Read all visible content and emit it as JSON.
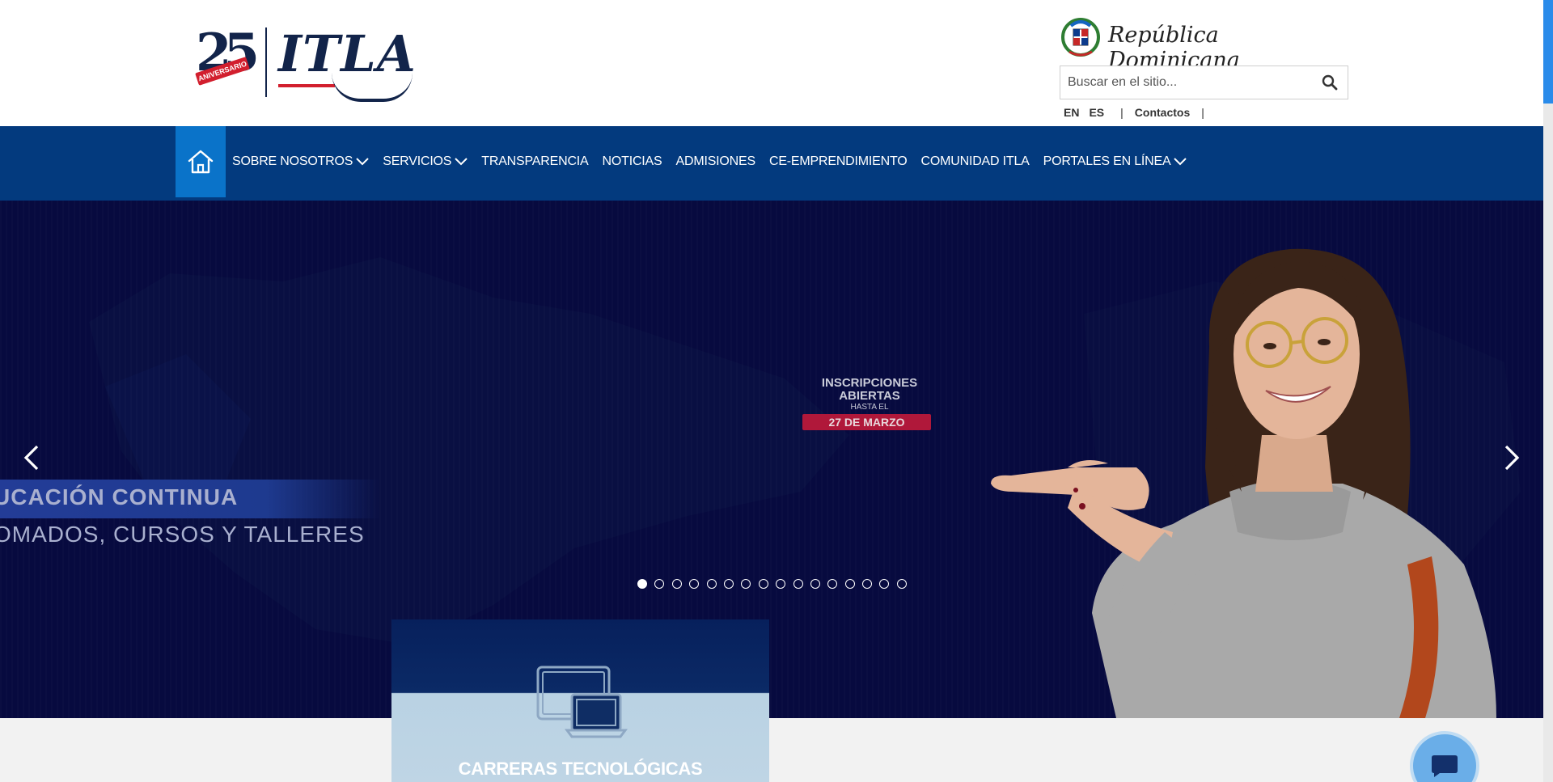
{
  "header": {
    "logo_text": "ITLA",
    "logo_anniversary_number": "25",
    "logo_anniversary_label": "ANIVERSARIO",
    "gov_text": "República Dominicana",
    "search_placeholder": "Buscar en el sitio...",
    "lang_en": "EN",
    "lang_es": "ES",
    "separator": "|",
    "contacts_label": "Contactos"
  },
  "nav": {
    "items": [
      {
        "label": "SOBRE NOSOTROS",
        "dropdown": true
      },
      {
        "label": "SERVICIOS",
        "dropdown": true
      },
      {
        "label": "TRANSPARENCIA",
        "dropdown": false
      },
      {
        "label": "NOTICIAS",
        "dropdown": false
      },
      {
        "label": "ADMISIONES",
        "dropdown": false
      },
      {
        "label": "CE-EMPRENDIMIENTO",
        "dropdown": false
      },
      {
        "label": "COMUNIDAD ITLA",
        "dropdown": false
      },
      {
        "label": "PORTALES EN LÍNEA",
        "dropdown": true
      }
    ]
  },
  "hero": {
    "promo_title": "INSCRIPCIONES ABIERTAS",
    "promo_sub": "HASTA EL",
    "promo_date": "27 DE MARZO",
    "edu_title": "UCACIÓN CONTINUA",
    "edu_sub": "OMADOS, CURSOS Y TALLERES",
    "slide_count": 16,
    "active_slide": 1
  },
  "cards": [
    {
      "label": "CARRERAS TECNOLÓGICAS",
      "icon": "devices-icon"
    }
  ],
  "colors": {
    "nav_bg": "#033a7e",
    "home_bg": "#0a73c9",
    "hero_bg": "#070a3f",
    "brand_navy": "#12244a",
    "brand_red": "#d21f2e"
  }
}
